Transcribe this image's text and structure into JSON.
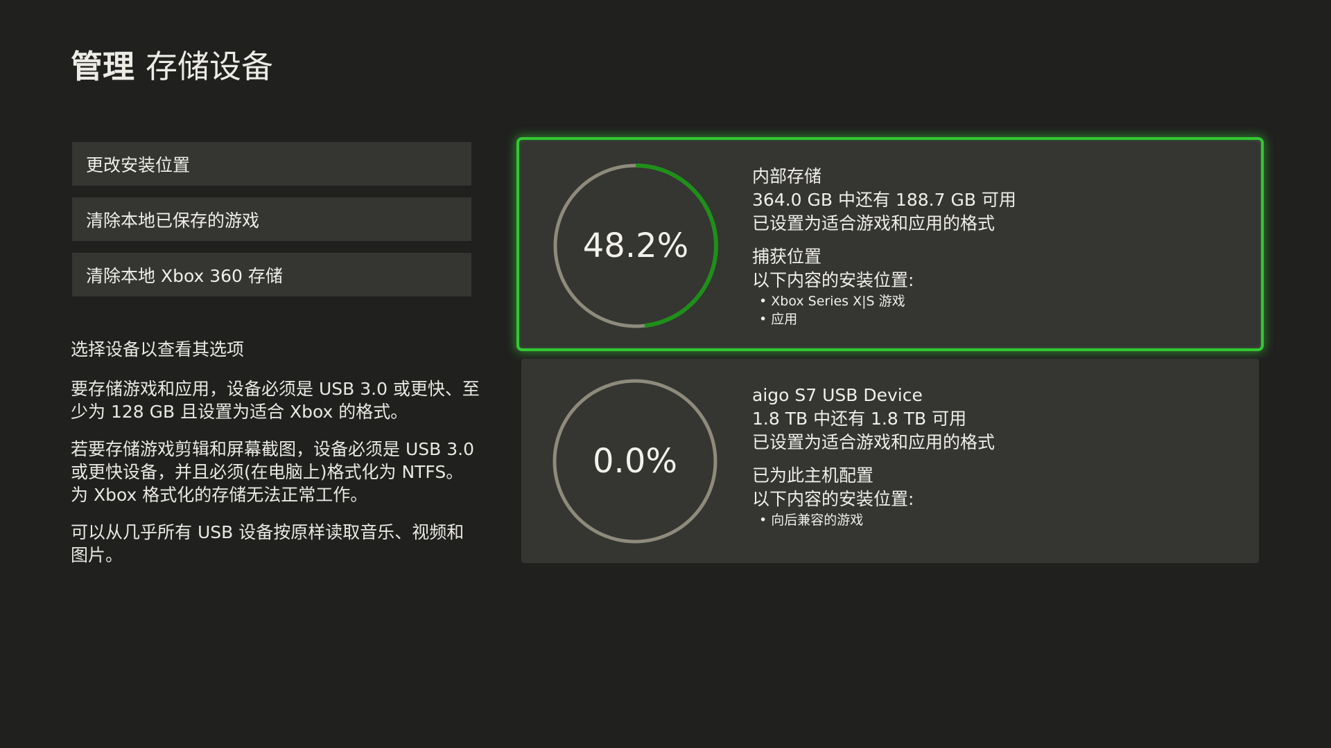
{
  "header": {
    "title_main": "管理",
    "title_sub": "存储设备"
  },
  "menu": {
    "items": [
      {
        "label": "更改安装位置"
      },
      {
        "label": "清除本地已保存的游戏"
      },
      {
        "label": "清除本地 Xbox 360 存储"
      }
    ]
  },
  "info": {
    "heading": "选择设备以查看其选项",
    "paragraphs": [
      "要存储游戏和应用，设备必须是 USB 3.0 或更快、至少为 128 GB 且设置为适合 Xbox 的格式。",
      "若要存储游戏剪辑和屏幕截图，设备必须是 USB 3.0 或更快设备，并且必须(在电脑上)格式化为 NTFS。为 Xbox 格式化的存储无法正常工作。",
      "可以从几乎所有 USB 设备按原样读取音乐、视频和图片。"
    ]
  },
  "devices": [
    {
      "percent_label": "48.2%",
      "used_fraction": 0.482,
      "name": "内部存储",
      "capacity": "364.0 GB 中还有 188.7 GB 可用",
      "format": "已设置为适合游戏和应用的格式",
      "role": "捕获位置",
      "install_heading": "以下内容的安装位置:",
      "install_items": [
        "Xbox Series X|S 游戏",
        "应用"
      ],
      "selected": true
    },
    {
      "percent_label": "0.0%",
      "used_fraction": 0.0,
      "name": "aigo S7 USB Device",
      "capacity": "1.8 TB 中还有 1.8 TB 可用",
      "format": "已设置为适合游戏和应用的格式",
      "role": "已为此主机配置",
      "install_heading": "以下内容的安装位置:",
      "install_items": [
        "向后兼容的游戏"
      ],
      "selected": false
    }
  ],
  "colors": {
    "background": "#20201e",
    "panel": "#353532",
    "accent_green": "#32c832",
    "ring_progress": "#1f8f1a",
    "ring_track": "#8e8b7c"
  }
}
